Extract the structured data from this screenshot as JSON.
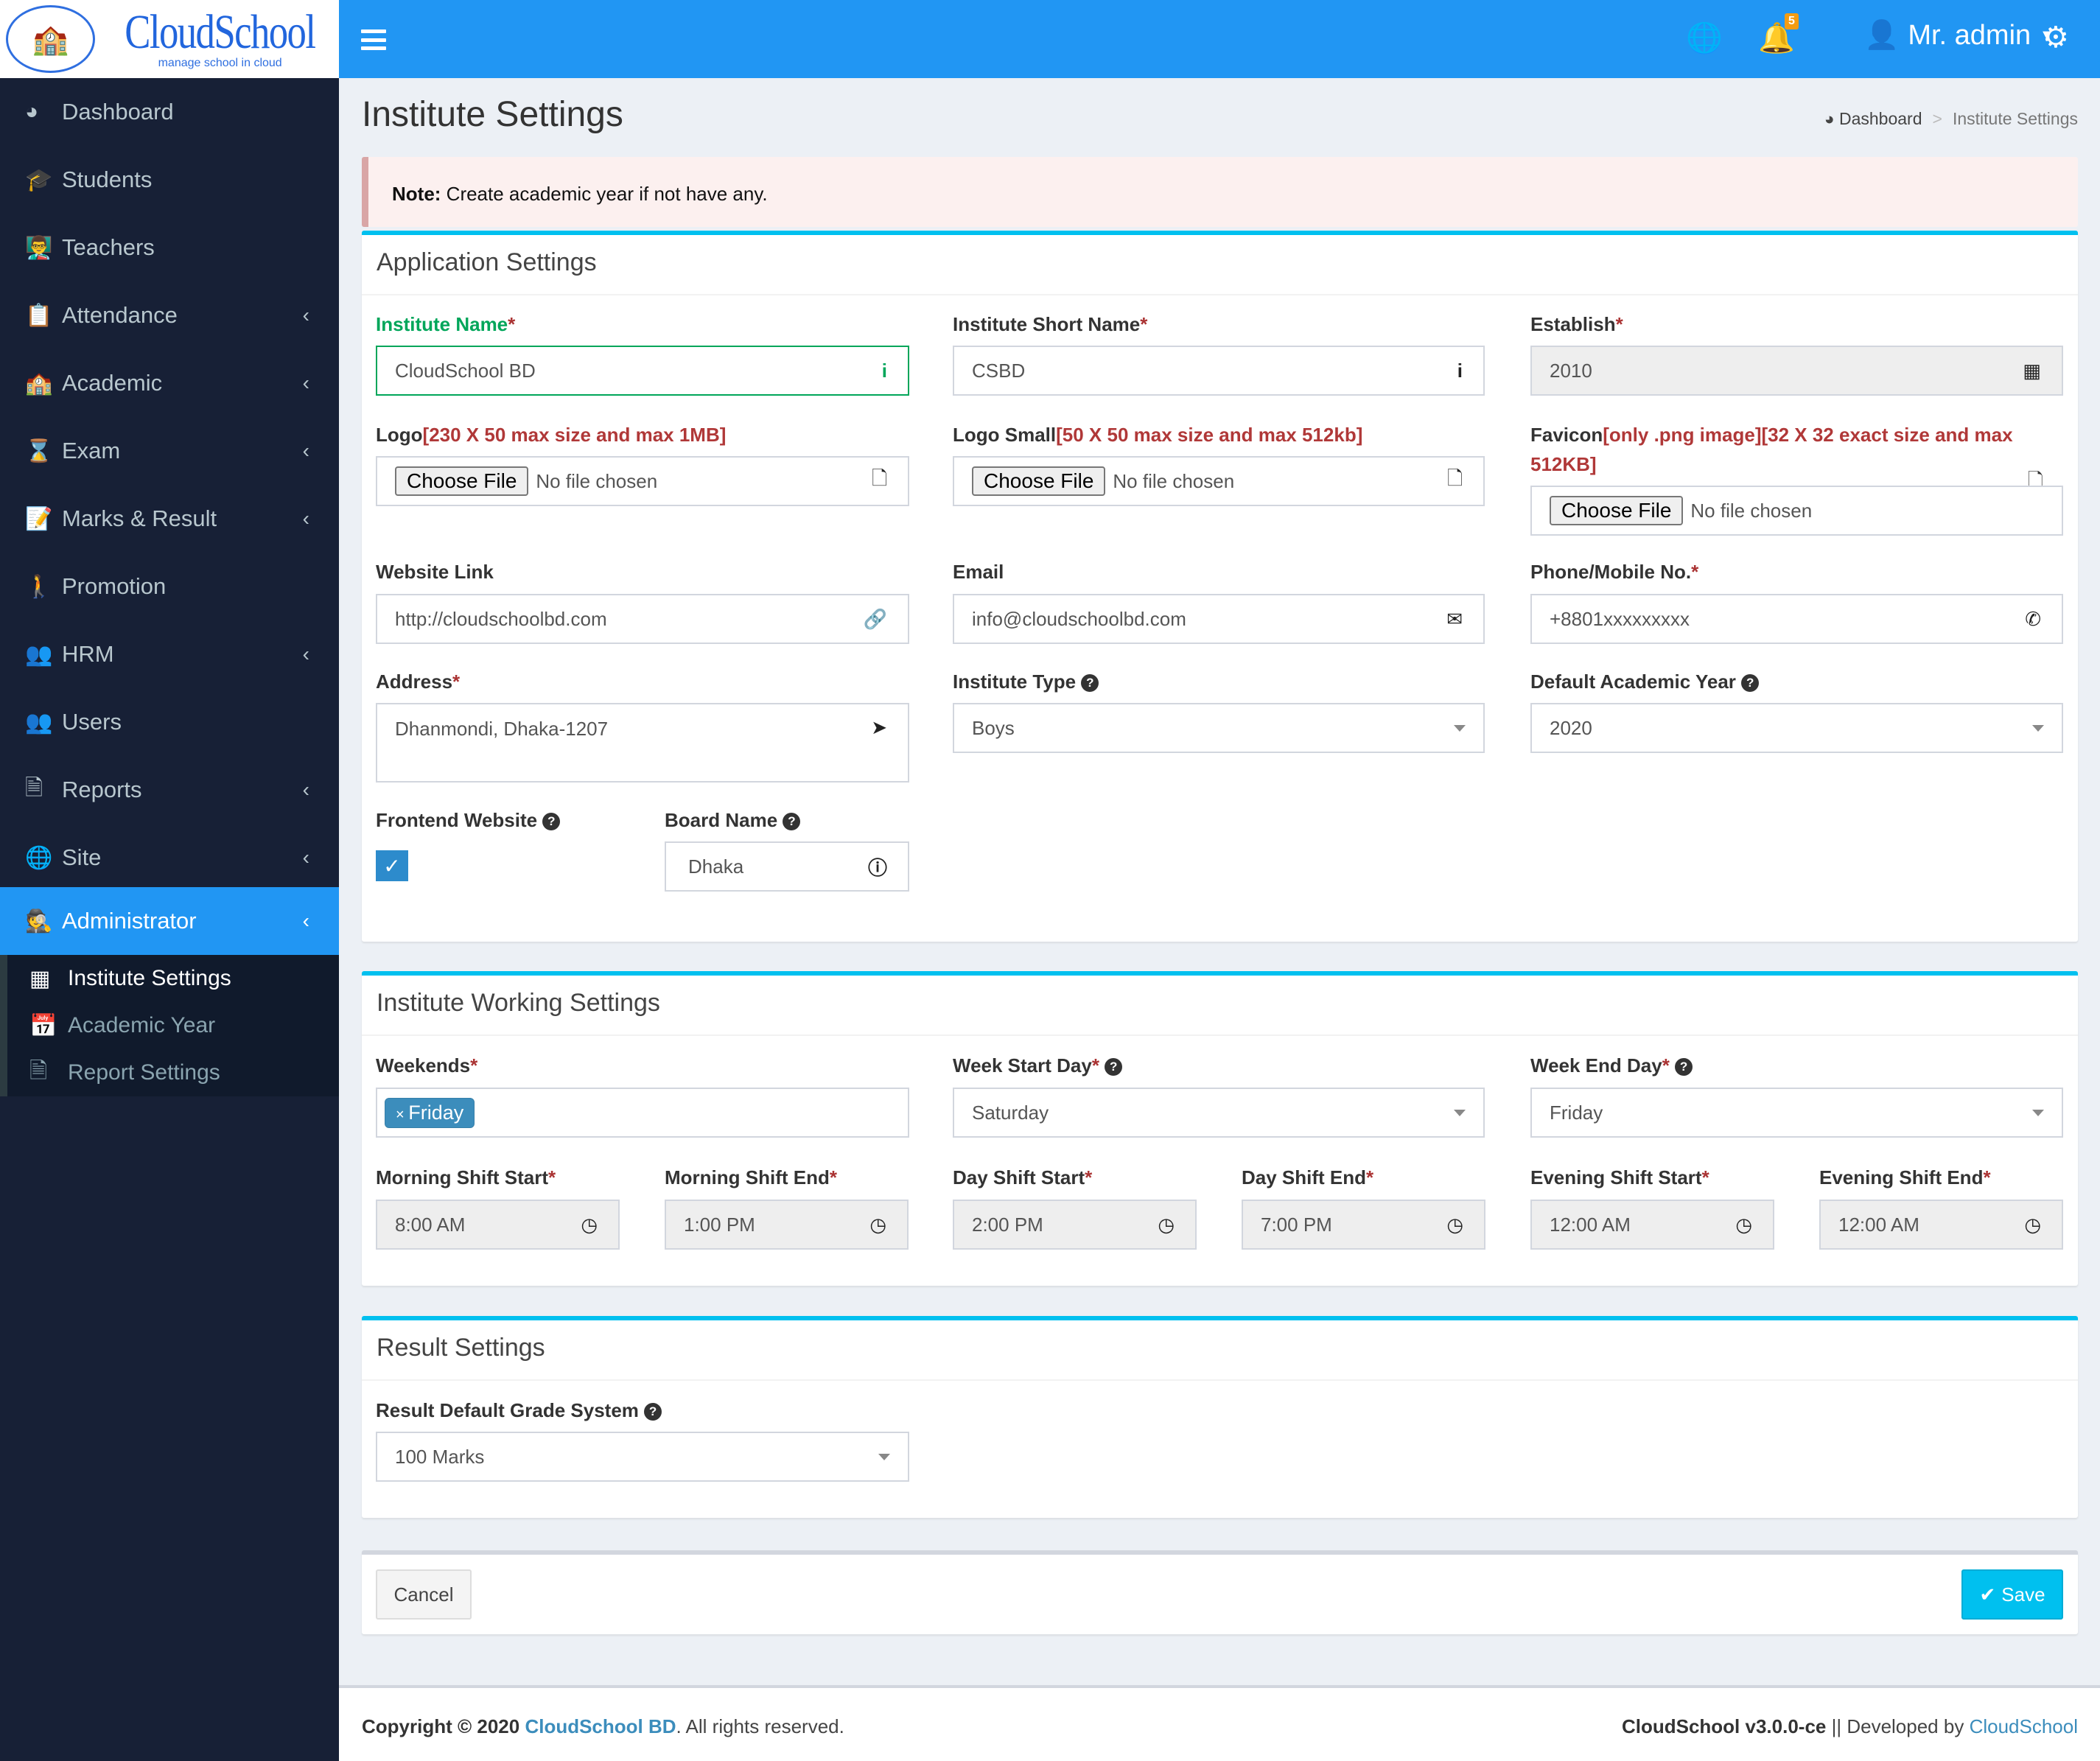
{
  "logo": {
    "brand": "CloudSchool",
    "tagline": "manage school in cloud"
  },
  "topbar": {
    "notifications_count": "5",
    "user_name": "Mr. admin"
  },
  "sidebar": {
    "items": [
      {
        "label": "Dashboard",
        "icon": "dashboard-icon"
      },
      {
        "label": "Students",
        "icon": "graduate-icon"
      },
      {
        "label": "Teachers",
        "icon": "teacher-icon"
      },
      {
        "label": "Attendance",
        "icon": "clipboard-icon"
      },
      {
        "label": "Academic",
        "icon": "school-icon"
      },
      {
        "label": "Exam",
        "icon": "hourglass-icon"
      },
      {
        "label": "Marks & Result",
        "icon": "edit-check-icon"
      },
      {
        "label": "Promotion",
        "icon": "promotion-icon"
      },
      {
        "label": "HRM",
        "icon": "users-icon"
      },
      {
        "label": "Users",
        "icon": "users-icon"
      },
      {
        "label": "Reports",
        "icon": "pdf-icon"
      },
      {
        "label": "Site",
        "icon": "globe-icon"
      },
      {
        "label": "Administrator",
        "icon": "admin-icon"
      }
    ],
    "submenu": [
      {
        "label": "Institute Settings"
      },
      {
        "label": "Academic Year"
      },
      {
        "label": "Report Settings"
      }
    ]
  },
  "page": {
    "title": "Institute Settings",
    "breadcrumb": [
      "Dashboard",
      "Institute Settings"
    ]
  },
  "note": {
    "bold": "Note:",
    "text": " Create academic year if not have any."
  },
  "app_settings": {
    "title": "Application Settings",
    "institute_name": {
      "label": "Institute Name",
      "value": "CloudSchool BD"
    },
    "short_name": {
      "label": "Institute Short Name",
      "value": "CSBD"
    },
    "establish": {
      "label": "Establish",
      "value": "2010"
    },
    "logo": {
      "label": "Logo",
      "hint": "[230 X 50 max size and max 1MB]"
    },
    "logo_small": {
      "label": "Logo Small",
      "hint": "[50 X 50 max size and max 512kb]"
    },
    "favicon": {
      "label": "Favicon",
      "hint": "[only .png image][32 X 32 exact size and max 512KB]"
    },
    "file_button": "Choose File",
    "no_file": "No file chosen",
    "website": {
      "label": "Website Link",
      "value": "http://cloudschoolbd.com"
    },
    "email": {
      "label": "Email",
      "value": "info@cloudschoolbd.com"
    },
    "phone": {
      "label": "Phone/Mobile No.",
      "value": "+8801xxxxxxxxx"
    },
    "address": {
      "label": "Address",
      "value": "Dhanmondi, Dhaka-1207"
    },
    "institute_type": {
      "label": "Institute Type",
      "value": "Boys"
    },
    "academic_year": {
      "label": "Default Academic Year",
      "value": "2020"
    },
    "frontend": {
      "label": "Frontend Website",
      "checked": true
    },
    "board": {
      "label": "Board Name",
      "value": "Dhaka"
    }
  },
  "working": {
    "title": "Institute Working Settings",
    "weekends": {
      "label": "Weekends",
      "tags": [
        "Friday"
      ]
    },
    "week_start": {
      "label": "Week Start Day",
      "value": "Saturday"
    },
    "week_end": {
      "label": "Week End Day",
      "value": "Friday"
    },
    "shifts": [
      {
        "label": "Morning Shift Start",
        "value": "8:00 AM"
      },
      {
        "label": "Morning Shift End",
        "value": "1:00 PM"
      },
      {
        "label": "Day Shift Start",
        "value": "2:00 PM"
      },
      {
        "label": "Day Shift End",
        "value": "7:00 PM"
      },
      {
        "label": "Evening Shift Start",
        "value": "12:00 AM"
      },
      {
        "label": "Evening Shift End",
        "value": "12:00 AM"
      }
    ]
  },
  "result": {
    "title": "Result Settings",
    "grade": {
      "label": "Result Default Grade System",
      "value": "100 Marks"
    }
  },
  "actions": {
    "cancel": "Cancel",
    "save": "Save"
  },
  "footer": {
    "copyright": "Copyright © 2020 ",
    "company": "CloudSchool BD",
    "rights": ". All rights reserved.",
    "version": "CloudSchool v3.0.0-ce",
    "dev": " || Developed by ",
    "dev_link": "CloudSchool"
  },
  "req": "*"
}
